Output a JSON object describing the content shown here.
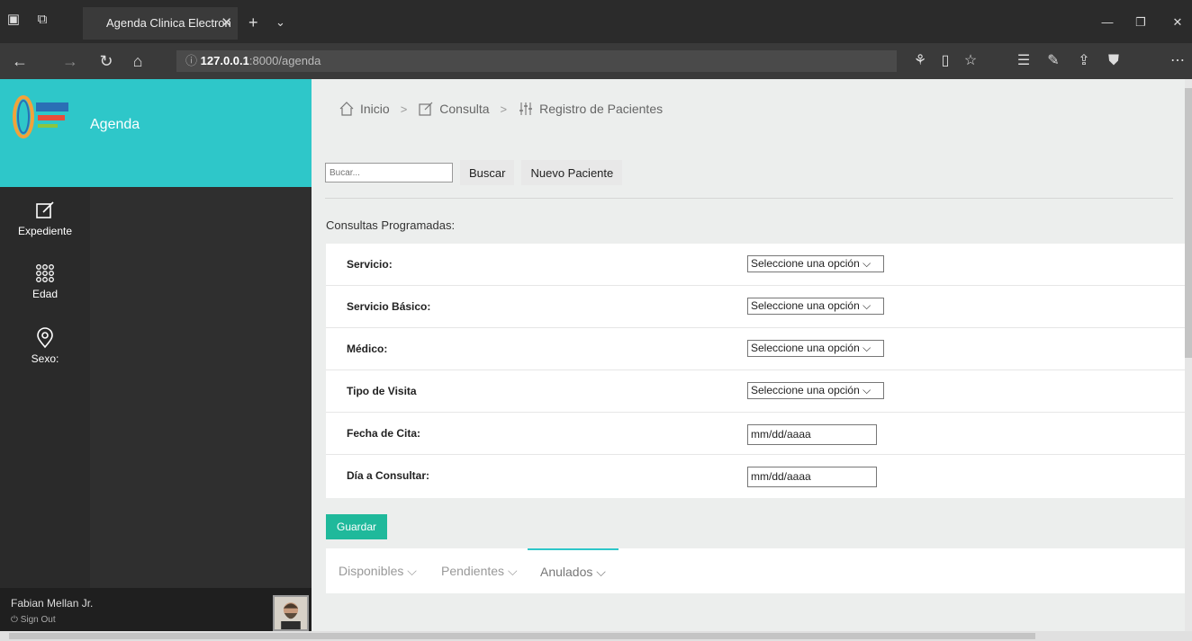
{
  "browser": {
    "tab_title": "Agenda Clinica Electron",
    "url_host": "127.0.0.1",
    "url_rest": ":8000/agenda"
  },
  "sidebar": {
    "brand_title": "Agenda",
    "items": [
      {
        "label": "Expediente",
        "icon": "edit-icon"
      },
      {
        "label": "Edad",
        "icon": "grid-icon"
      },
      {
        "label": "Sexo:",
        "icon": "location-pin-icon"
      }
    ],
    "user": {
      "name": "Fabian Mellan Jr.",
      "signout": "Sign Out"
    }
  },
  "breadcrumb": [
    {
      "label": "Inicio",
      "icon": "home-icon"
    },
    {
      "label": "Consulta",
      "icon": "edit-icon"
    },
    {
      "label": "Registro de Pacientes",
      "icon": "sliders-icon"
    }
  ],
  "search": {
    "placeholder": "Bucar...",
    "button": "Buscar",
    "new_button": "Nuevo Paciente"
  },
  "section_title": "Consultas Programadas:",
  "form": {
    "rows": [
      {
        "label": "Servicio:",
        "value": "Seleccione una opción"
      },
      {
        "label": "Servicio Básico:",
        "value": "Seleccione una opción"
      },
      {
        "label": "Médico:",
        "value": "Seleccione una opción"
      },
      {
        "label": "Tipo de Visita",
        "value": "Seleccione una opción"
      },
      {
        "label": "Fecha de Cita:",
        "value": "mm/dd/aaaa"
      },
      {
        "label": "Día a Consultar:",
        "value": "mm/dd/aaaa"
      }
    ],
    "save_label": "Guardar"
  },
  "tabs": [
    {
      "label": "Disponibles"
    },
    {
      "label": "Pendientes"
    },
    {
      "label": "Anulados",
      "active": true
    }
  ],
  "colors": {
    "accent": "#2ec7c9",
    "save": "#1fb99b",
    "sidebar": "#2f2f2f"
  }
}
